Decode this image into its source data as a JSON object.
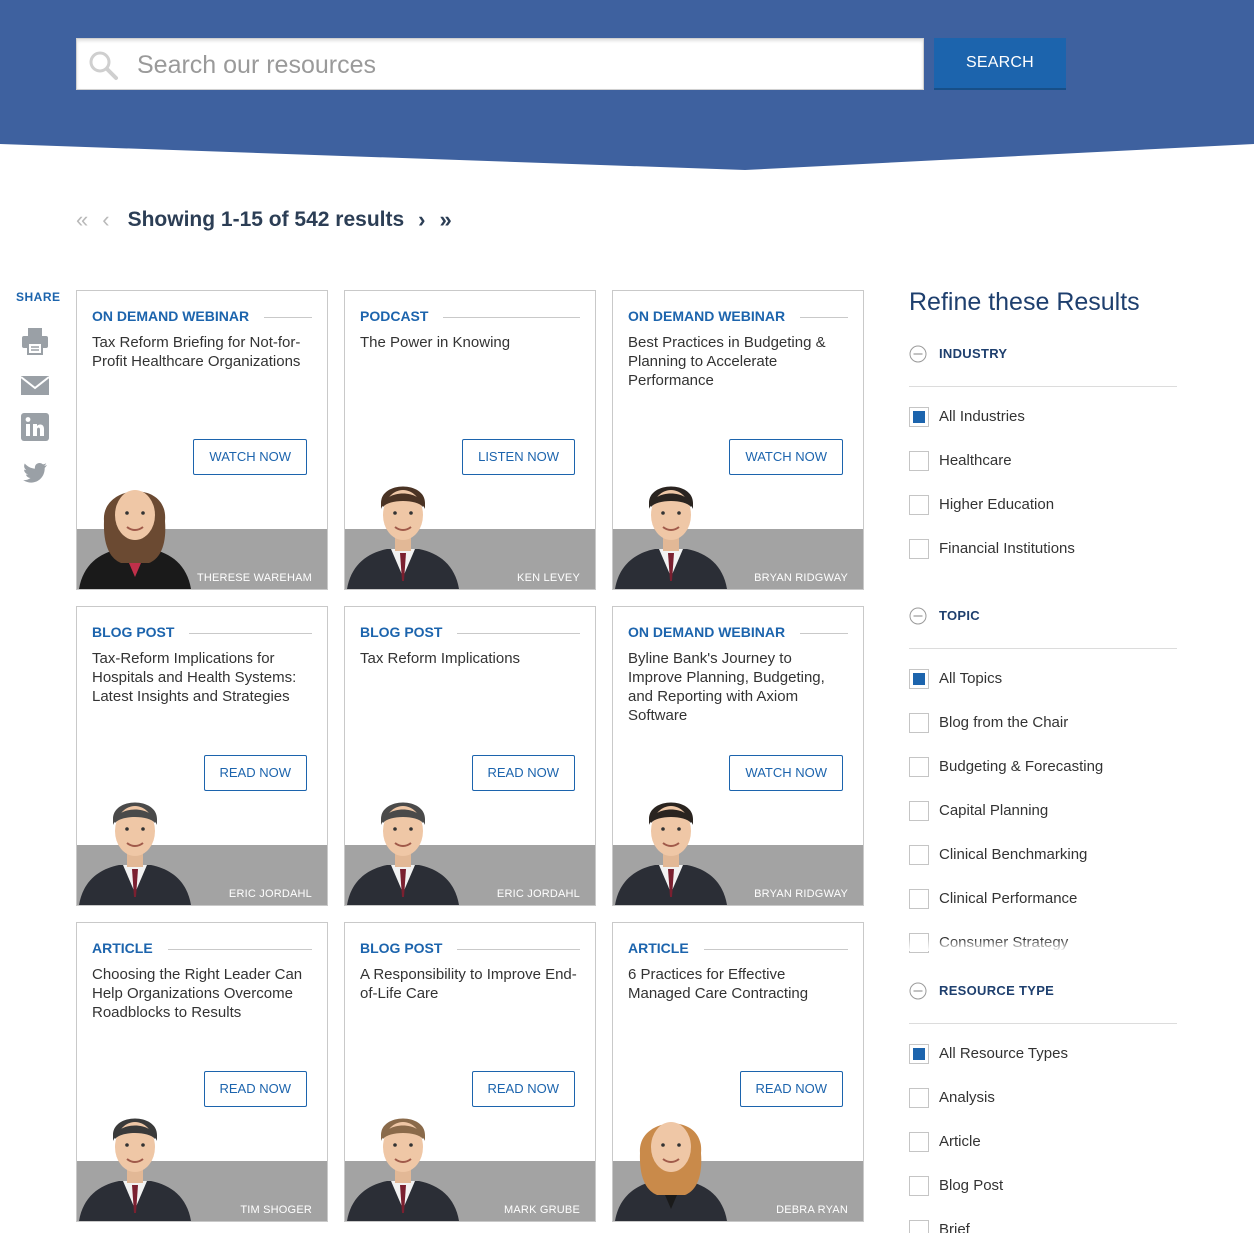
{
  "colors": {
    "header_bg": "#3e619f",
    "accent": "#1c64ad",
    "heading": "#2c3e55",
    "strip": "#a3a3a3"
  },
  "search": {
    "placeholder": "Search our resources",
    "button_label": "SEARCH"
  },
  "pager": {
    "first": "«",
    "prev": "‹",
    "summary": "Showing 1-15 of 542 results",
    "next": "›",
    "last": "»"
  },
  "share": {
    "label": "SHARE",
    "icons": [
      "print-icon",
      "email-icon",
      "linkedin-icon",
      "twitter-icon"
    ]
  },
  "cards": [
    {
      "category": "ON DEMAND WEBINAR",
      "title": "Tax Reform Briefing for Not-for-Profit Healthcare Organizations",
      "cta": "WATCH NOW",
      "person": "THERESE WAREHAM"
    },
    {
      "category": "PODCAST",
      "title": "The Power in Knowing",
      "cta": "LISTEN NOW",
      "person": "KEN LEVEY"
    },
    {
      "category": "ON DEMAND WEBINAR",
      "title": "Best Practices in Budgeting & Planning to Accelerate Performance",
      "cta": "WATCH NOW",
      "person": "BRYAN RIDGWAY"
    },
    {
      "category": "BLOG POST",
      "title": "Tax-Reform Implications for Hospitals and Health Systems: Latest Insights and Strategies",
      "cta": "READ NOW",
      "person": "ERIC JORDAHL"
    },
    {
      "category": "BLOG POST",
      "title": "Tax Reform Implications",
      "cta": "READ NOW",
      "person": "ERIC JORDAHL"
    },
    {
      "category": "ON DEMAND WEBINAR",
      "title": "Byline Bank's Journey to Improve Planning, Budgeting, and Reporting with Axiom Software",
      "cta": "WATCH NOW",
      "person": "BRYAN RIDGWAY"
    },
    {
      "category": "ARTICLE",
      "title": "Choosing the Right Leader Can Help Organizations Overcome Roadblocks to Results",
      "cta": "READ NOW",
      "person": "TIM SHOGER"
    },
    {
      "category": "BLOG POST",
      "title": "A Responsibility to Improve End-of-Life Care",
      "cta": "READ NOW",
      "person": "MARK GRUBE"
    },
    {
      "category": "ARTICLE",
      "title": "6 Practices for Effective Managed Care Contracting",
      "cta": "READ NOW",
      "person": "DEBRA RYAN"
    }
  ],
  "refine": {
    "title": "Refine these Results",
    "groups": [
      {
        "label": "INDUSTRY",
        "options": [
          {
            "label": "All Industries",
            "checked": true
          },
          {
            "label": "Healthcare",
            "checked": false
          },
          {
            "label": "Higher Education",
            "checked": false
          },
          {
            "label": "Financial Institutions",
            "checked": false
          }
        ]
      },
      {
        "label": "TOPIC",
        "options": [
          {
            "label": "All Topics",
            "checked": true
          },
          {
            "label": "Blog from the Chair",
            "checked": false
          },
          {
            "label": "Budgeting & Forecasting",
            "checked": false
          },
          {
            "label": "Capital Planning",
            "checked": false
          },
          {
            "label": "Clinical Benchmarking",
            "checked": false
          },
          {
            "label": "Clinical Performance",
            "checked": false
          },
          {
            "label": "Consumer Strategy",
            "checked": false
          }
        ]
      },
      {
        "label": "RESOURCE TYPE",
        "options": [
          {
            "label": "All Resource Types",
            "checked": true
          },
          {
            "label": "Analysis",
            "checked": false
          },
          {
            "label": "Article",
            "checked": false
          },
          {
            "label": "Blog Post",
            "checked": false
          },
          {
            "label": "Brief",
            "checked": false
          }
        ]
      }
    ]
  }
}
